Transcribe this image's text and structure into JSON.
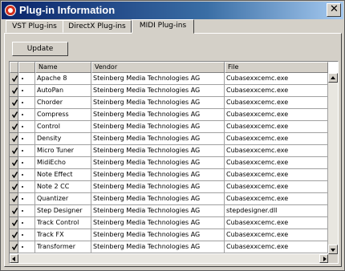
{
  "window": {
    "title": "Plug-in Information",
    "close_glyph": "✕"
  },
  "tabs": [
    {
      "label": "VST Plug-ins"
    },
    {
      "label": "DirectX Plug-ins"
    },
    {
      "label": "MIDI Plug-ins"
    }
  ],
  "active_tab": "MIDI Plug-ins",
  "update_label": "Update",
  "table": {
    "columns": [
      "",
      "",
      "Name",
      "Vendor",
      "File"
    ],
    "rows": [
      {
        "checked": true,
        "name": "Apache 8",
        "vendor": "Steinberg Media Technologies AG",
        "file": "Cubasexxcemc.exe"
      },
      {
        "checked": true,
        "name": "AutoPan",
        "vendor": "Steinberg Media Technologies AG",
        "file": "Cubasexxcemc.exe"
      },
      {
        "checked": true,
        "name": "Chorder",
        "vendor": "Steinberg Media Technologies AG",
        "file": "Cubasexxcemc.exe"
      },
      {
        "checked": true,
        "name": "Compress",
        "vendor": "Steinberg Media Technologies AG",
        "file": "Cubasexxcemc.exe"
      },
      {
        "checked": true,
        "name": "Control",
        "vendor": "Steinberg Media Technologies AG",
        "file": "Cubasexxcemc.exe"
      },
      {
        "checked": true,
        "name": "Density",
        "vendor": "Steinberg Media Technologies AG",
        "file": "Cubasexxcemc.exe"
      },
      {
        "checked": true,
        "name": "Micro Tuner",
        "vendor": "Steinberg Media Technologies AG",
        "file": "Cubasexxcemc.exe"
      },
      {
        "checked": true,
        "name": "MidiEcho",
        "vendor": "Steinberg Media Technologies AG",
        "file": "Cubasexxcemc.exe"
      },
      {
        "checked": true,
        "name": "Note Effect",
        "vendor": "Steinberg Media Technologies AG",
        "file": "Cubasexxcemc.exe"
      },
      {
        "checked": true,
        "name": "Note 2 CC",
        "vendor": "Steinberg Media Technologies AG",
        "file": "Cubasexxcemc.exe"
      },
      {
        "checked": true,
        "name": "Quantizer",
        "vendor": "Steinberg Media Technologies AG",
        "file": "Cubasexxcemc.exe"
      },
      {
        "checked": true,
        "name": "Step Designer",
        "vendor": "Steinberg Media Technologies AG",
        "file": "stepdesigner.dll"
      },
      {
        "checked": true,
        "name": "Track Control",
        "vendor": "Steinberg Media Technologies AG",
        "file": "Cubasexxcemc.exe"
      },
      {
        "checked": true,
        "name": "Track FX",
        "vendor": "Steinberg Media Technologies AG",
        "file": "Cubasexxcemc.exe"
      },
      {
        "checked": true,
        "name": "Transformer",
        "vendor": "Steinberg Media Technologies AG",
        "file": "Cubasexxcemc.exe"
      }
    ]
  },
  "colors": {
    "title_bar_start": "#0a246a",
    "title_bar_end": "#a6caf0",
    "window_face": "#d4d0c8",
    "app_icon": "#d12f1d"
  },
  "icons": {
    "app": "cubase-logo-icon",
    "close": "close-icon",
    "check": "checkmark-icon"
  }
}
